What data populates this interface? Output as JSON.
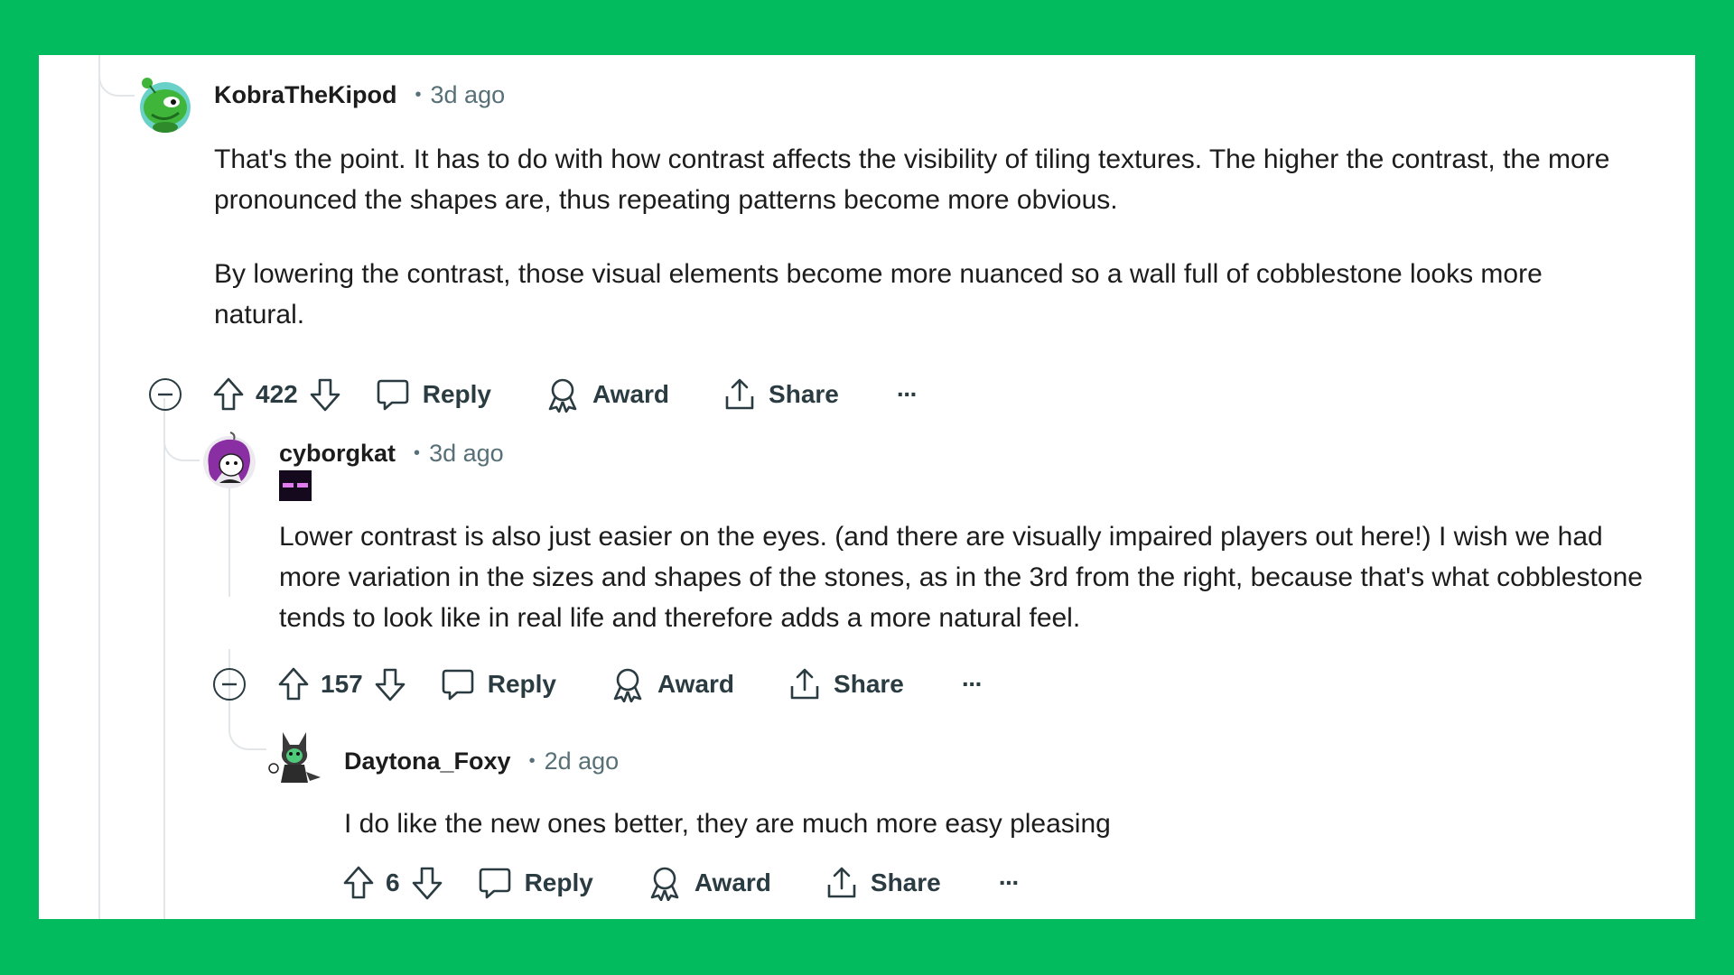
{
  "comments": [
    {
      "username": "KobraTheKipod",
      "separator": "•",
      "time": "3d ago",
      "paragraphs": [
        "That's the point. It has to do with how contrast affects the visibility of tiling textures. The higher the contrast, the more pronounced the shapes are, thus repeating patterns become more obvious.",
        "By lowering the contrast, those visual elements become more nuanced so a wall full of cobblestone looks more natural."
      ],
      "score": "422",
      "reply_label": "Reply",
      "award_label": "Award",
      "share_label": "Share",
      "more_label": "···"
    },
    {
      "username": "cyborgkat",
      "separator": "•",
      "time": "3d ago",
      "paragraphs": [
        "Lower contrast is also just easier on the eyes. (and there are visually impaired players out here!) I wish we had more variation in the sizes and shapes of the stones, as in the 3rd from the right, because that's what cobblestone tends to look like in real life and therefore adds a more natural feel."
      ],
      "score": "157",
      "reply_label": "Reply",
      "award_label": "Award",
      "share_label": "Share",
      "more_label": "···"
    },
    {
      "username": "Daytona_Foxy",
      "separator": "•",
      "time": "2d ago",
      "paragraphs": [
        "I do like the new ones better, they are much more easy pleasing"
      ],
      "score": "6",
      "reply_label": "Reply",
      "award_label": "Award",
      "share_label": "Share",
      "more_label": "···"
    }
  ],
  "colors": {
    "frame": "#03bb5f",
    "card": "#ffffff",
    "text": "#1c1c1c",
    "meta": "#576f76",
    "thread_line": "#e3e6e8"
  },
  "icons": [
    "collapse-icon",
    "upvote-icon",
    "downvote-icon",
    "comment-icon",
    "award-icon",
    "share-icon",
    "more-icon"
  ]
}
